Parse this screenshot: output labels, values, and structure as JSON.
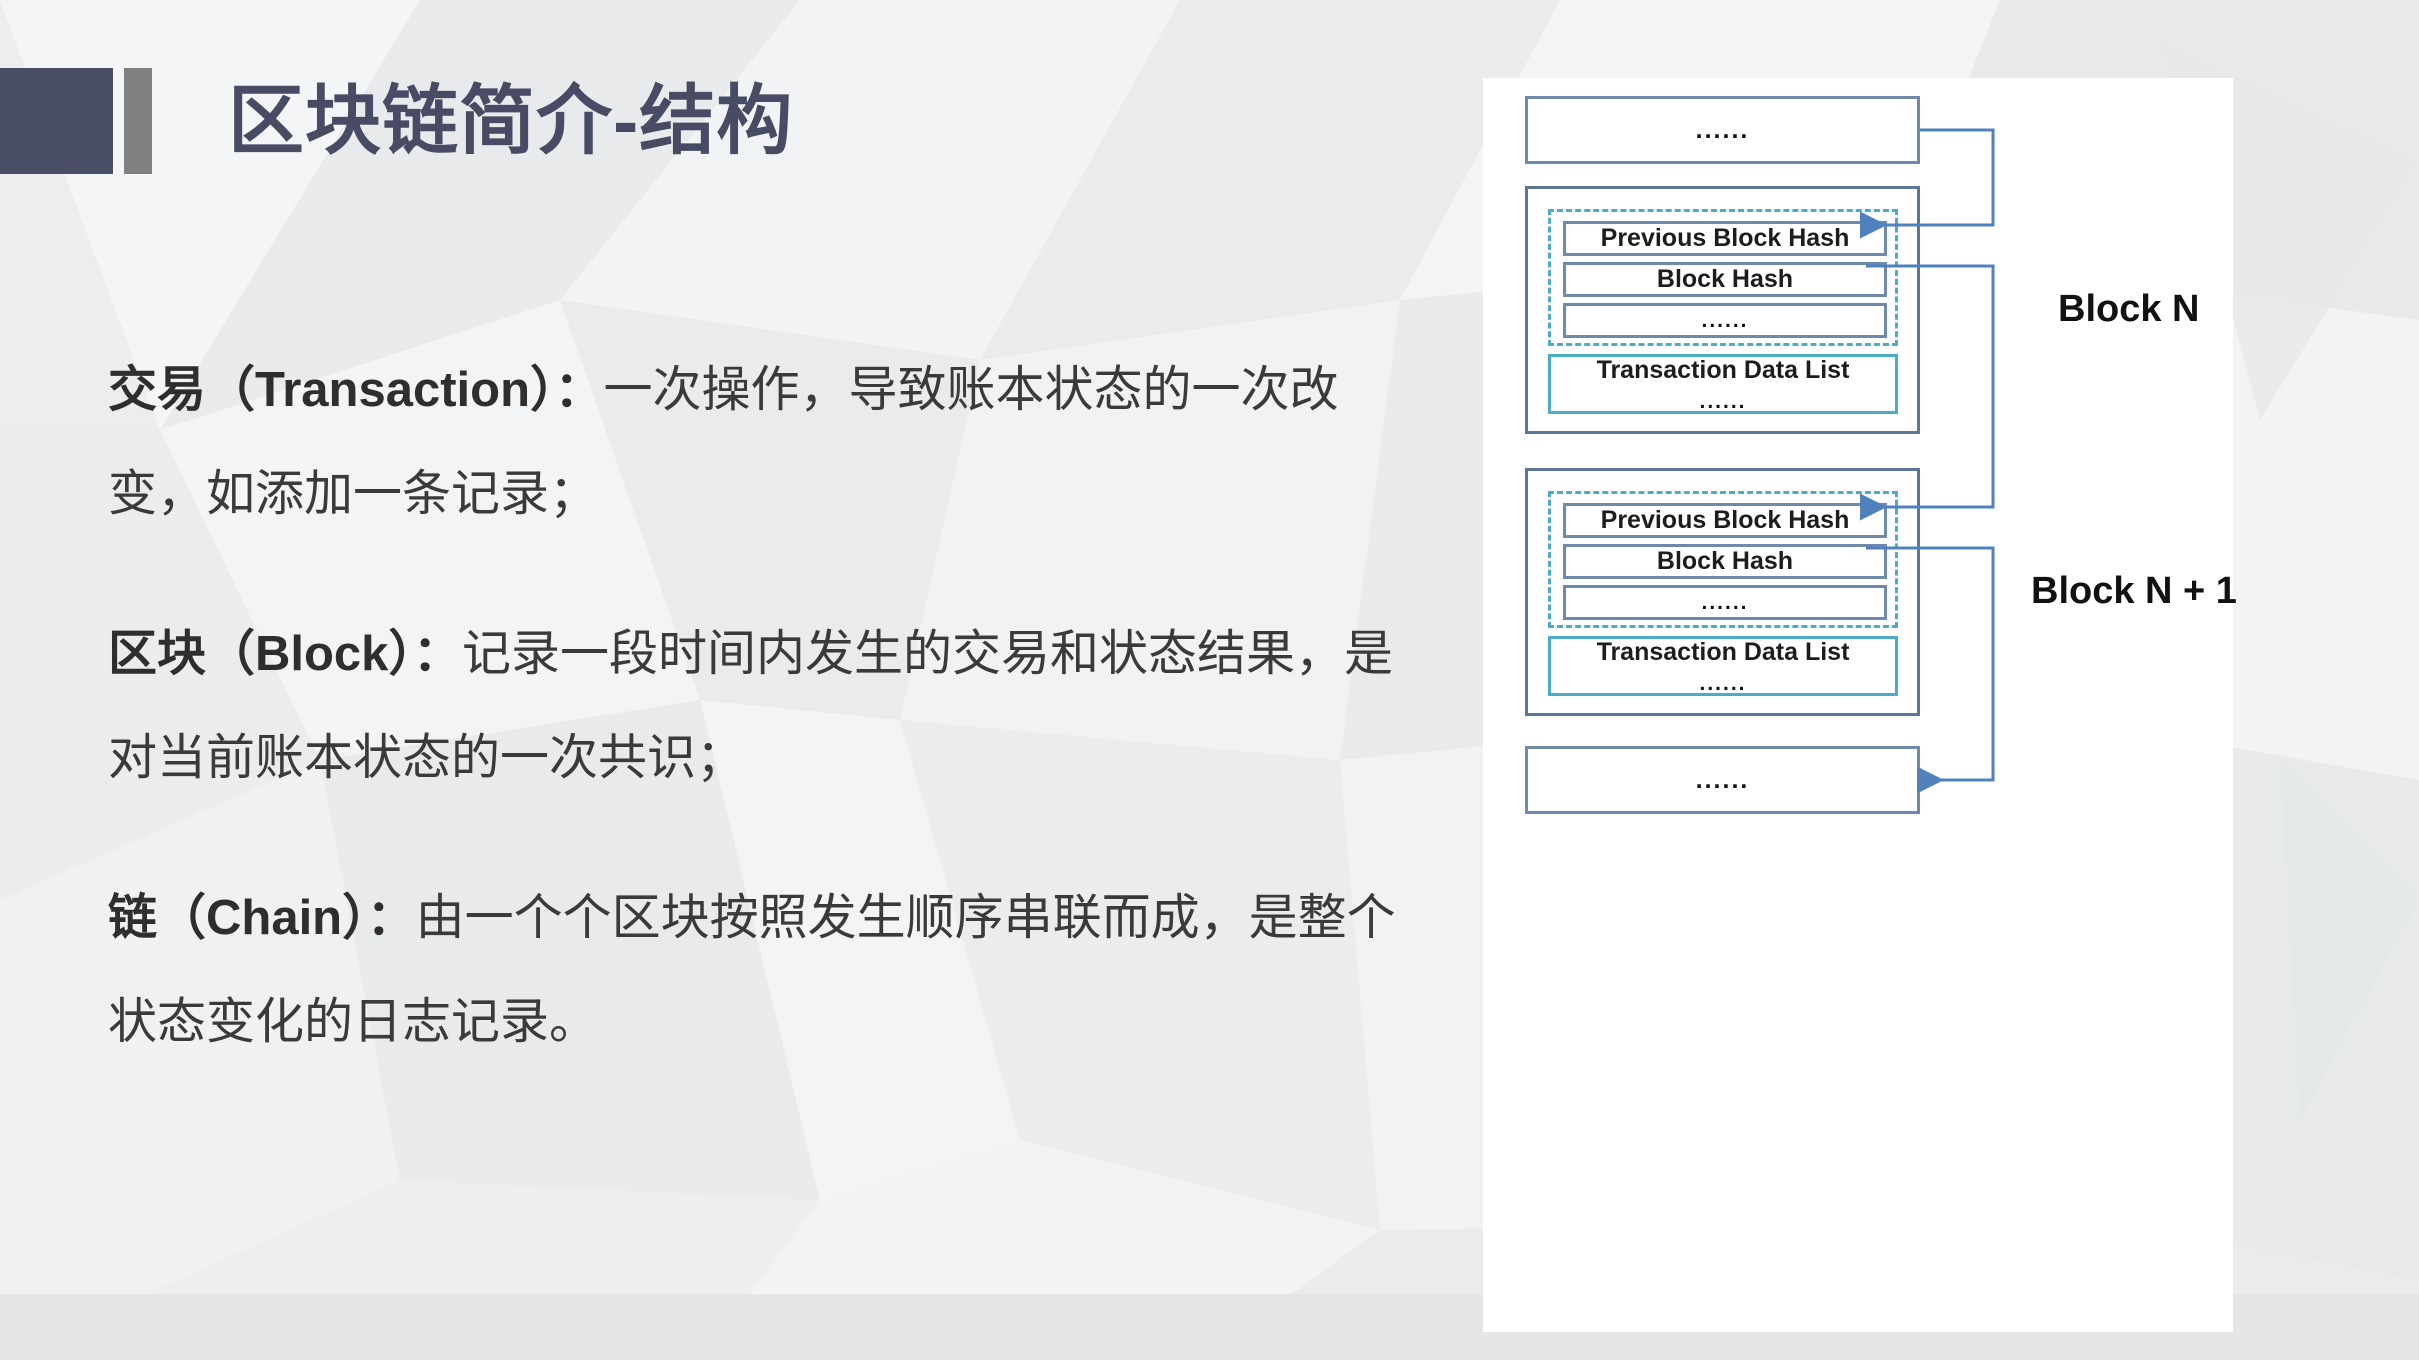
{
  "slide": {
    "title": "区块链简介-结构",
    "accent_navy": "#4a4d66",
    "accent_gray": "#808080",
    "body_text_color": "#3a3a3a",
    "panel_bg": "#ffffff",
    "connector_color": "#4f81bd",
    "box_border_color": "#6e89ab",
    "dashed_border_color": "#4aacc5"
  },
  "body": {
    "paragraphs": [
      {
        "term": "交易（Transaction）：",
        "text": "一次操作，导致账本状态的一次改变，如添加一条记录；"
      },
      {
        "term": "区块（Block）：",
        "text": "记录一段时间内发生的交易和状态结果，是对当前账本状态的一次共识；"
      },
      {
        "term": "链（Chain）：",
        "text": "由一个个区块按照发生顺序串联而成，是整个状态变化的日志记录。"
      }
    ]
  },
  "diagram": {
    "ellipsis": "......",
    "top_box": {
      "label": "......"
    },
    "bottom_box": {
      "label": "......"
    },
    "blocks": [
      {
        "label": "Block N",
        "header_fields": [
          "Previous Block Hash",
          "Block Hash",
          "......"
        ],
        "transaction_section": {
          "title": "Transaction Data List",
          "ellipsis": "......"
        }
      },
      {
        "label": "Block N + 1",
        "header_fields": [
          "Previous Block Hash",
          "Block Hash",
          "......"
        ],
        "transaction_section": {
          "title": "Transaction Data List",
          "ellipsis": "......"
        }
      }
    ]
  }
}
